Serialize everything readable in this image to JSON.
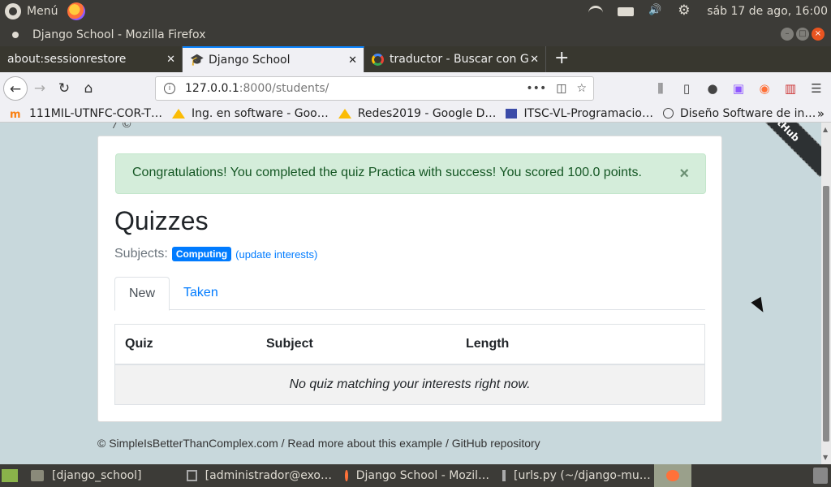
{
  "system_panel": {
    "menu_label": "Menú",
    "clock": "sáb 17 de ago, 16:00"
  },
  "window": {
    "title": "Django School - Mozilla Firefox"
  },
  "tabs": [
    {
      "label": "about:sessionrestore",
      "close": "✕"
    },
    {
      "label": "Django School",
      "close": "✕"
    },
    {
      "label": "traductor - Buscar con G",
      "close": "✕"
    }
  ],
  "newtab": "+",
  "urlbar": {
    "host": "127.0.0.1",
    "rest": ":8000/students/",
    "more": "•••"
  },
  "bookmarks": [
    {
      "label": "111MIL-UTNFC-COR-T…"
    },
    {
      "label": "Ing. en software - Goo…"
    },
    {
      "label": "Redes2019 - Google D…"
    },
    {
      "label": "ITSC-VL-Programacio…"
    },
    {
      "label": "Diseño Software de in…"
    }
  ],
  "bookmarks_overflow": "»",
  "page": {
    "ribbon": "GitHub",
    "alert": "Congratulations! You completed the quiz Practica with success! You scored 100.0 points.",
    "alert_close": "×",
    "title": "Quizzes",
    "subjects_label": "Subjects:",
    "subject_badge": "Computing",
    "update_link": "(update interests)",
    "tabs": [
      "New",
      "Taken"
    ],
    "table": {
      "headers": [
        "Quiz",
        "Subject",
        "Length"
      ],
      "empty_message": "No quiz matching your interests right now."
    },
    "footer": {
      "copyright": "© SimpleIsBetterThanComplex.com",
      "sep1": " / ",
      "read_more": "Read more about this example",
      "sep2": " / ",
      "repo": "GitHub repository"
    }
  },
  "taskbar": [
    {
      "label": "[django_school]"
    },
    {
      "label": "[administrador@exo…"
    },
    {
      "label": "Django School - Mozil…"
    },
    {
      "label": "[urls.py (~/django-mu…"
    }
  ]
}
